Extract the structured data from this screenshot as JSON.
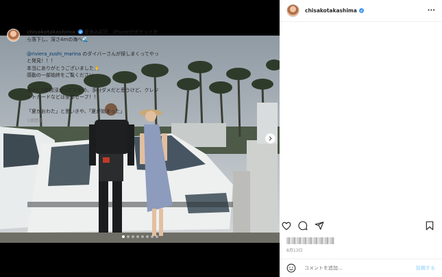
{
  "post": {
    "username": "chisakotakashima",
    "caption_lines": [
      "夏休み初日　iPhoneがポケットから落下し、深さ4mの海へ🌊"
    ],
    "mention": "@riviera_zushi_marina",
    "mention_tail": " のダイバーさんが探しまくってやっと発見！！！",
    "line_thanks": "本当にありがとうございました🙏",
    "line_moved": "感動の一部始終をご覧ください",
    "line_sea": "海水に2時間浸かってたため、多分ダメだと思うけど、クレジットカードなどは全部セーフ！！",
    "line_summer": "「夏がおわた」と思いきや、「夏が始まった」",
    "time_ago": "1週間前",
    "date": "8月13日"
  },
  "comment": {
    "placeholder": "コメントを追加...",
    "post_label": "投稿する"
  },
  "media": {
    "dot_count": 8,
    "active_dot": 0
  }
}
